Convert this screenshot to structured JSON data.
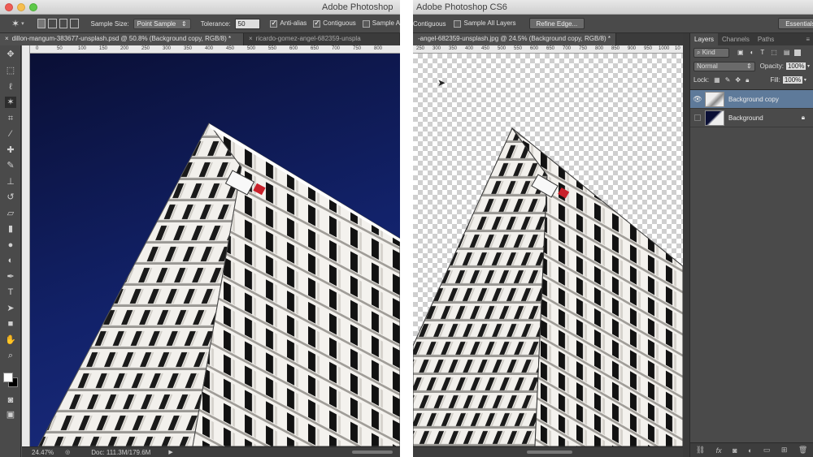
{
  "left_window": {
    "app_title": "Adobe Photoshop",
    "options": {
      "sample_size_label": "Sample Size:",
      "sample_size_value": "Point Sample",
      "tolerance_label": "Tolerance:",
      "tolerance_value": "50",
      "anti_alias_label": "Anti-alias",
      "contiguous_label": "Contiguous",
      "sample_all_label": "Sample A"
    },
    "tabs": [
      "dillon-mangum-383677-unsplash.psd @ 50.8% (Background copy, RGB/8) *",
      "ricardo-gomez-angel-682359-unspla"
    ],
    "ruler_ticks": [
      "0",
      "50",
      "100",
      "150",
      "200",
      "250",
      "300",
      "350",
      "400",
      "450",
      "500",
      "550",
      "600",
      "650",
      "700",
      "750",
      "800"
    ],
    "status": {
      "zoom": "24.47%",
      "doc": "Doc: 111.3M/179.6M"
    }
  },
  "right_window": {
    "app_title": "Adobe Photoshop CS6",
    "options": {
      "contiguous_label": "Contiguous",
      "sample_all_layers_label": "Sample All Layers",
      "refine_edge_label": "Refine Edge...",
      "workspace_label": "Essentials"
    },
    "tabs": [
      "-angel-682359-unsplash.jpg @ 24.5% (Background copy, RGB/8) *"
    ],
    "ruler_ticks": [
      "250",
      "300",
      "350",
      "400",
      "450",
      "500",
      "550",
      "600",
      "650",
      "700",
      "750",
      "800",
      "850",
      "900",
      "950",
      "1000",
      "10"
    ],
    "layers_panel": {
      "tabs": [
        "Layers",
        "Channels",
        "Paths"
      ],
      "filter_kind": "Kind",
      "blend_mode": "Normal",
      "opacity_label": "Opacity:",
      "opacity_value": "100%",
      "lock_label": "Lock:",
      "fill_label": "Fill:",
      "fill_value": "100%",
      "layers": [
        {
          "name": "Background copy",
          "visible": true,
          "selected": true
        },
        {
          "name": "Background",
          "visible": false,
          "selected": false,
          "locked": true
        }
      ]
    }
  },
  "colors": {
    "sky_dark": "#0a0f35",
    "sky_light": "#1d2f85",
    "selected_layer": "#5e7a9a",
    "panel_bg": "#4a4a4a"
  },
  "icons": {
    "toolbox": [
      "move-icon",
      "marquee-icon",
      "lasso-icon",
      "magic-wand-icon",
      "crop-icon",
      "eyedropper-icon",
      "healing-icon",
      "brush-icon",
      "stamp-icon",
      "history-brush-icon",
      "eraser-icon",
      "gradient-icon",
      "blur-icon",
      "dodge-icon",
      "pen-icon",
      "type-icon",
      "path-select-icon",
      "rectangle-icon",
      "hand-icon",
      "zoom-icon"
    ]
  }
}
